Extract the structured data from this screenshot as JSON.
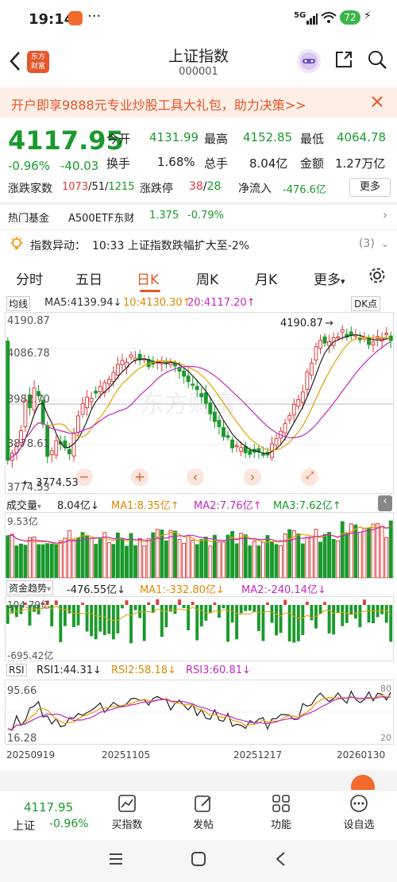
{
  "status": {
    "time": "19:14",
    "network": "5G",
    "battery": "72"
  },
  "header": {
    "logo_line1": "东方",
    "logo_line2": "财富",
    "title": "上证指数",
    "code": "000001"
  },
  "banner": {
    "text": "开户即享9888元专业炒股工具大礼包，助力决策>>"
  },
  "quote": {
    "price": "4117.95",
    "change_pct": "-0.96%",
    "change": "-40.03",
    "open_label": "今开",
    "open": "4131.99",
    "high_label": "最高",
    "high": "4152.85",
    "low_label": "最低",
    "low": "4064.78",
    "turnover_label": "换手",
    "turnover": "1.68%",
    "volume_label": "总手",
    "volume": "8.04亿",
    "amount_label": "金额",
    "amount": "1.27万亿",
    "updown_label": "涨跌家数",
    "up": "1073",
    "flat": "51",
    "down": "1215",
    "limit_label": "涨跌停",
    "limit_up": "38",
    "limit_down": "28",
    "netflow_label": "净流入",
    "netflow": "-476.6亿",
    "more": "更多"
  },
  "hot": {
    "label": "热门基金",
    "fund": "A500ETF东财",
    "price": "1.375",
    "pct": "-0.79%"
  },
  "alert": {
    "label": "指数异动：",
    "text": "10:33 上证指数跌幅扩大至-2%",
    "count": "(3)"
  },
  "tabs": [
    {
      "label": "分时"
    },
    {
      "label": "五日"
    },
    {
      "label": "日K"
    },
    {
      "label": "周K"
    },
    {
      "label": "月K"
    },
    {
      "label": "更多"
    }
  ],
  "kline": {
    "ma_label": "均线",
    "ma5": "MA5:4139.94↓",
    "ma10": "10:4130.30↑",
    "ma20": "20:4117.20↑",
    "dk": "DK点",
    "y_top": "4190.87",
    "y2": "4086.78",
    "y3": "3982.70",
    "y4": "3878.61",
    "y_bottom": "3774.53",
    "max_marker": "4190.87",
    "min_marker": "3774.53",
    "watermark": "东方财富"
  },
  "vol": {
    "label": "成交量",
    "value": "8.04亿↓",
    "ma1": "MA1:8.35亿↑",
    "ma2": "MA2:7.76亿↑",
    "ma3": "MA3:7.62亿↑",
    "ymax": "9.53亿"
  },
  "fund": {
    "label": "资金趋势",
    "value": "-476.55亿↓",
    "ma1": "MA1:-332.80亿↓",
    "ma2": "MA2:-240.14亿↓",
    "ymax": "104.79亿",
    "ymin": "-695.42亿"
  },
  "rsi": {
    "label": "RSI",
    "rsi1": "RSI1:44.31↓",
    "rsi2": "RSI2:58.18↓",
    "rsi3": "RSI3:60.81↓",
    "top": "95.66",
    "bottom": "16.28",
    "r80": "80",
    "r20": "20"
  },
  "dates": [
    "20250919",
    "20251105",
    "20251217",
    "20260130"
  ],
  "bottom_nav": {
    "price": "4117.95",
    "name": "上证",
    "pct": "-0.96%",
    "items": [
      {
        "label": "买指数"
      },
      {
        "label": "发帖"
      },
      {
        "label": "功能"
      },
      {
        "label": "设自选"
      }
    ]
  },
  "colors": {
    "up": "#e23b3b",
    "down": "#1a9a2c",
    "accent": "#e4572a"
  }
}
